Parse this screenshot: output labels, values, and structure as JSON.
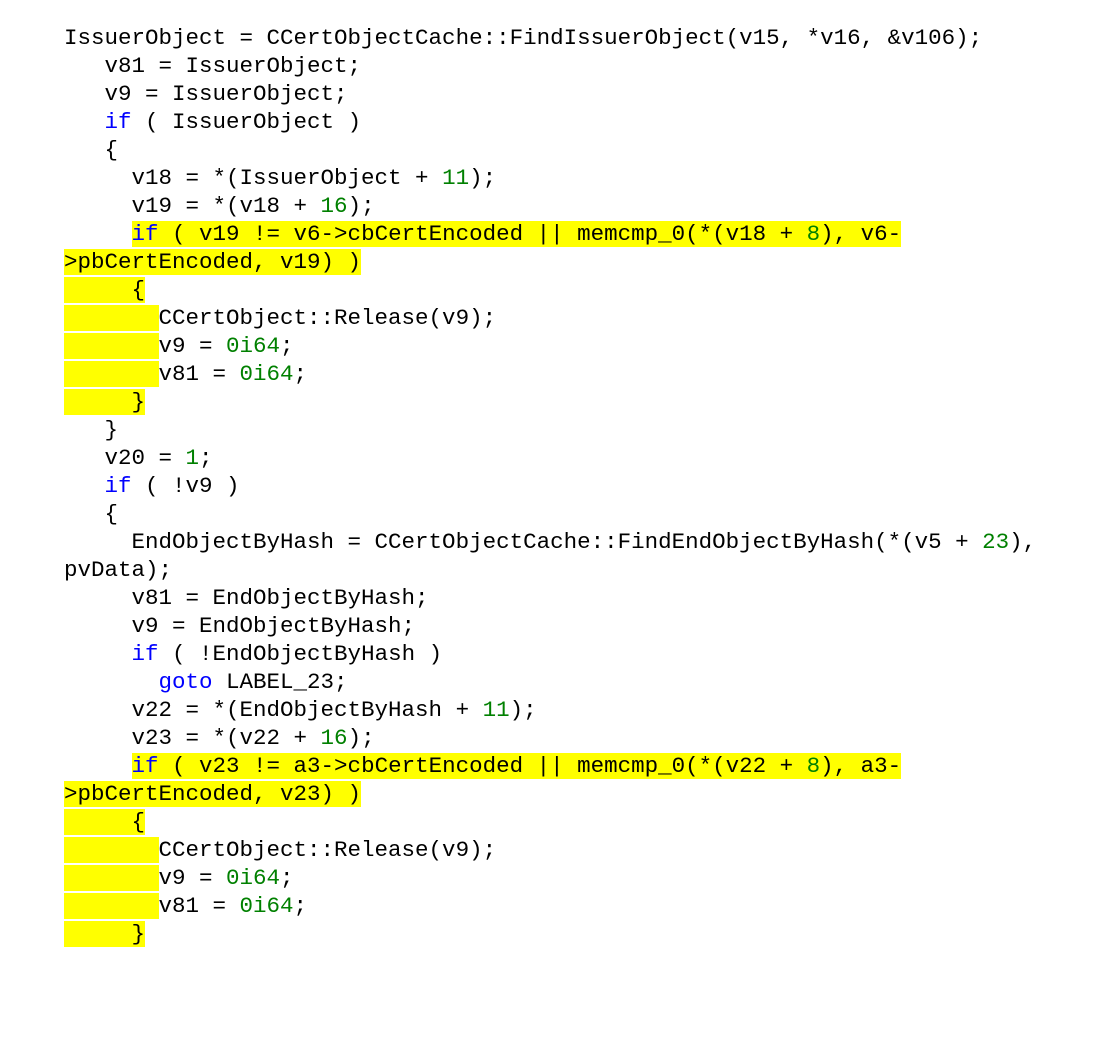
{
  "code": {
    "tokens": [
      {
        "cls": "",
        "text": "IssuerObject = CCertObjectCache::FindIssuerObject(v15, *v16, &v106);\n"
      },
      {
        "cls": "",
        "text": "   v81 = IssuerObject;\n"
      },
      {
        "cls": "",
        "text": "   v9 = IssuerObject;\n"
      },
      {
        "cls": "",
        "text": "   "
      },
      {
        "cls": "kw",
        "text": "if"
      },
      {
        "cls": "",
        "text": " ( IssuerObject )\n"
      },
      {
        "cls": "",
        "text": "   {\n"
      },
      {
        "cls": "",
        "text": "     v18 = *(IssuerObject + "
      },
      {
        "cls": "num",
        "text": "11"
      },
      {
        "cls": "",
        "text": ");\n"
      },
      {
        "cls": "",
        "text": "     v19 = *(v18 + "
      },
      {
        "cls": "num",
        "text": "16"
      },
      {
        "cls": "",
        "text": ");\n"
      },
      {
        "cls": "",
        "text": "     "
      },
      {
        "cls": "hlkw",
        "text": "if"
      },
      {
        "cls": "hl",
        "text": " ( v19 != v6->cbCertEncoded || memcmp_0(*(v18 + "
      },
      {
        "cls": "hlnum",
        "text": "8"
      },
      {
        "cls": "hl",
        "text": "), v6-\n>pbCertEncoded, v19) )\n"
      },
      {
        "cls": "hl",
        "text": "     {\n"
      },
      {
        "cls": "hl",
        "text": "       "
      },
      {
        "cls": "",
        "text": "CCertObject::Release(v9);\n"
      },
      {
        "cls": "hl",
        "text": "       "
      },
      {
        "cls": "",
        "text": "v9 = "
      },
      {
        "cls": "num",
        "text": "0i64"
      },
      {
        "cls": "",
        "text": ";\n"
      },
      {
        "cls": "hl",
        "text": "       "
      },
      {
        "cls": "",
        "text": "v81 = "
      },
      {
        "cls": "num",
        "text": "0i64"
      },
      {
        "cls": "",
        "text": ";\n"
      },
      {
        "cls": "hl",
        "text": "     }\n"
      },
      {
        "cls": "",
        "text": "   }\n"
      },
      {
        "cls": "",
        "text": "   v20 = "
      },
      {
        "cls": "num",
        "text": "1"
      },
      {
        "cls": "",
        "text": ";\n"
      },
      {
        "cls": "",
        "text": "   "
      },
      {
        "cls": "kw",
        "text": "if"
      },
      {
        "cls": "",
        "text": " ( !v9 )\n"
      },
      {
        "cls": "",
        "text": "   {\n"
      },
      {
        "cls": "",
        "text": "     EndObjectByHash = CCertObjectCache::FindEndObjectByHash(*(v5 + "
      },
      {
        "cls": "num",
        "text": "23"
      },
      {
        "cls": "",
        "text": "), \npvData);\n"
      },
      {
        "cls": "",
        "text": "     v81 = EndObjectByHash;\n"
      },
      {
        "cls": "",
        "text": "     v9 = EndObjectByHash;\n"
      },
      {
        "cls": "",
        "text": "     "
      },
      {
        "cls": "kw",
        "text": "if"
      },
      {
        "cls": "",
        "text": " ( !EndObjectByHash )\n"
      },
      {
        "cls": "",
        "text": "       "
      },
      {
        "cls": "kw",
        "text": "goto"
      },
      {
        "cls": "",
        "text": " LABEL_23;\n"
      },
      {
        "cls": "",
        "text": "     v22 = *(EndObjectByHash + "
      },
      {
        "cls": "num",
        "text": "11"
      },
      {
        "cls": "",
        "text": ");\n"
      },
      {
        "cls": "",
        "text": "     v23 = *(v22 + "
      },
      {
        "cls": "num",
        "text": "16"
      },
      {
        "cls": "",
        "text": ");\n"
      },
      {
        "cls": "",
        "text": "     "
      },
      {
        "cls": "hlkw",
        "text": "if"
      },
      {
        "cls": "hl",
        "text": " ( v23 != a3->cbCertEncoded || memcmp_0(*(v22 + "
      },
      {
        "cls": "hlnum",
        "text": "8"
      },
      {
        "cls": "hl",
        "text": "), a3-\n>pbCertEncoded, v23) )\n"
      },
      {
        "cls": "hl",
        "text": "     {\n"
      },
      {
        "cls": "hl",
        "text": "       "
      },
      {
        "cls": "",
        "text": "CCertObject::Release(v9);\n"
      },
      {
        "cls": "hl",
        "text": "       "
      },
      {
        "cls": "",
        "text": "v9 = "
      },
      {
        "cls": "num",
        "text": "0i64"
      },
      {
        "cls": "",
        "text": ";\n"
      },
      {
        "cls": "hl",
        "text": "       "
      },
      {
        "cls": "",
        "text": "v81 = "
      },
      {
        "cls": "num",
        "text": "0i64"
      },
      {
        "cls": "",
        "text": ";\n"
      },
      {
        "cls": "hl",
        "text": "     }"
      }
    ]
  }
}
